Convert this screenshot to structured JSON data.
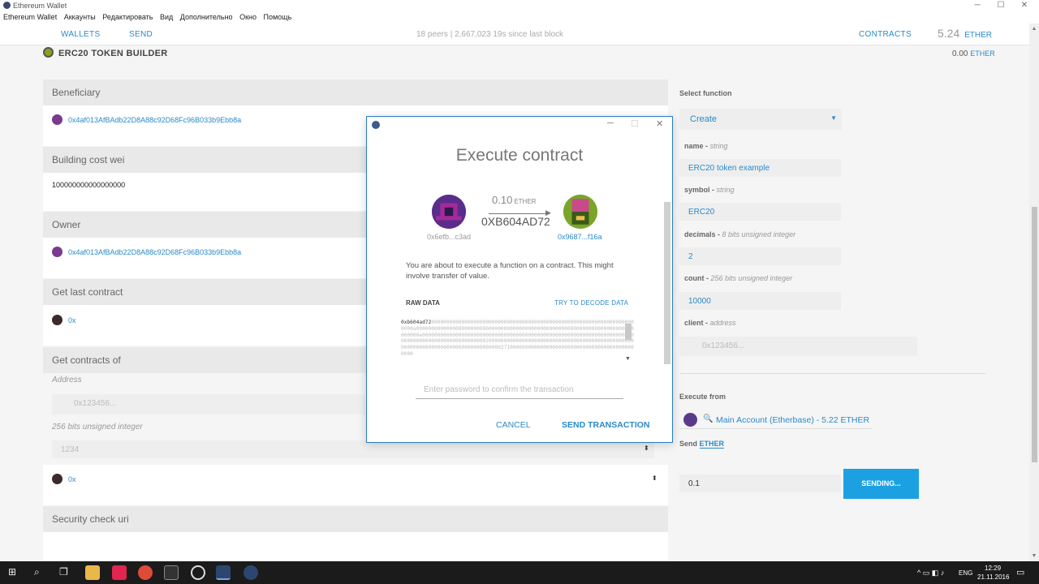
{
  "window": {
    "title": "Ethereum Wallet",
    "min": "─",
    "max": "☐",
    "close": "✕"
  },
  "menu": [
    "Ethereum Wallet",
    "Аккаунты",
    "Редактировать",
    "Вид",
    "Дополнительно",
    "Окно",
    "Помощь"
  ],
  "header": {
    "wallets": "WALLETS",
    "send": "SEND",
    "status": "18 peers  |  2,667,023  19s since last block",
    "contracts": "CONTRACTS",
    "balance": "5.24",
    "balance_unit": "ETHER"
  },
  "page": {
    "title": "ERC20 TOKEN BUILDER",
    "ether_value": "0.00",
    "ether_unit": "ETHER"
  },
  "sections": {
    "beneficiary": {
      "label": "Beneficiary",
      "address": "0x4af013AfBAdb22D8A88c92D68Fc96B033b9Ebb8a"
    },
    "building_cost": {
      "label": "Building cost wei",
      "value": "100000000000000000"
    },
    "owner": {
      "label": "Owner",
      "address": "0x4af013AfBAdb22D8A88c92D68Fc96B033b9Ebb8a"
    },
    "last_contract": {
      "label": "Get last contract",
      "value": "0x"
    },
    "contracts_of": {
      "label": "Get contracts of",
      "address_label": "Address",
      "address_placeholder": "0x123456...",
      "int_label": "256 bits unsigned integer",
      "int_placeholder": "1234",
      "value": "0x"
    },
    "security": {
      "label": "Security check uri"
    }
  },
  "right": {
    "select_label": "Select function",
    "select_value": "Create",
    "fields": [
      {
        "name": "name",
        "type": "string",
        "value": "ERC20 token example"
      },
      {
        "name": "symbol",
        "type": "string",
        "value": "ERC20"
      },
      {
        "name": "decimals",
        "type": "8 bits unsigned integer",
        "value": "2"
      },
      {
        "name": "count",
        "type": "256 bits unsigned integer",
        "value": "10000"
      },
      {
        "name": "client",
        "type": "address",
        "placeholder": "0x123456..."
      }
    ],
    "execute_from_label": "Execute from",
    "account": "Main Account (Etherbase) - 5.22 ETHER",
    "send_label": "Send",
    "send_unit": "ETHER",
    "send_value": "0.1",
    "sending": "SENDING..."
  },
  "modal": {
    "title": "Execute contract",
    "from": "0x6efb...c3ad",
    "amount": "0.10",
    "amount_unit": "ETHER",
    "function": "0XB604AD72",
    "to": "0x9687...f16a",
    "message": "You are about to execute a function on a contract. This might involve transfer of value.",
    "raw_label": "RAW DATA",
    "decode": "TRY TO DECODE DATA",
    "raw_prefix": "0xb604ad72",
    "raw_rest": "00000000000000000000000000000000000000000000000000000000000000000000000a000000000000000000000000000000000000000000000000000000000000000000000000000000e000000000000000000000000000000000000000000000000000000000000000000000000000000000000000000000000002000000000000000000000000000000000000000000000000000000000000000000000000000000000271000000000000000000000000000000000000000000000",
    "password_placeholder": "Enter password to confirm the transaction",
    "cancel": "CANCEL",
    "send": "SEND TRANSACTION"
  },
  "taskbar": {
    "lang": "ENG",
    "time": "12:29",
    "date": "21.11.2016"
  }
}
